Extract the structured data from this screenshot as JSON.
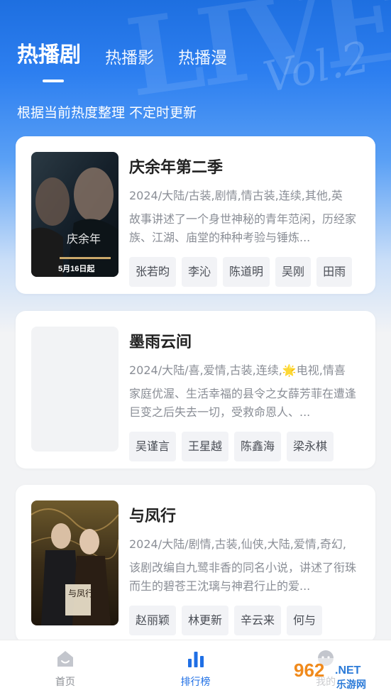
{
  "tabs": [
    {
      "label": "热播剧",
      "active": true
    },
    {
      "label": "热播影",
      "active": false
    },
    {
      "label": "热播漫",
      "active": false
    }
  ],
  "subtitle": "根据当前热度整理 不定时更新",
  "cards": [
    {
      "title": "庆余年第二季",
      "meta": "2024/大陆/古装,剧情,情古装,连续,其他,英",
      "desc": "故事讲述了一个身世神秘的青年范闲，历经家族、江湖、庙堂的种种考验与锤炼...",
      "tags": [
        "张若昀",
        "李沁",
        "陈道明",
        "吴刚",
        "田雨"
      ],
      "poster_text": "庆余年",
      "poster_date": "5月16日起"
    },
    {
      "title": "墨雨云间",
      "meta": "2024/大陆/喜,爱情,古装,连续,🌟电视,情喜",
      "desc": "家庭优渥、生活幸福的县令之女薛芳菲在遭逢巨变之后失去一切，受救命恩人、...",
      "tags": [
        "吴谨言",
        "王星越",
        "陈鑫海",
        "梁永棋"
      ]
    },
    {
      "title": "与凤行",
      "meta": "2024/大陆/剧情,古装,仙侠,大陆,爱情,奇幻,",
      "desc": "该剧改编自九鹭非香的同名小说，讲述了衔珠而生的碧苍王沈璃与神君行止的爱...",
      "tags": [
        "赵丽颖",
        "林更新",
        "辛云来",
        "何与"
      ],
      "poster_text": "与凤行"
    }
  ],
  "nav": [
    {
      "label": "首页",
      "icon": "home-icon"
    },
    {
      "label": "排行榜",
      "icon": "chart-icon",
      "active": true
    },
    {
      "label": "我的",
      "icon": "profile-icon"
    }
  ],
  "watermark": {
    "brand": "962",
    "suffix": ".NET",
    "site": "乐游网"
  },
  "colors": {
    "accent": "#1f6fe5",
    "bg_top": "#1e6fe0"
  }
}
